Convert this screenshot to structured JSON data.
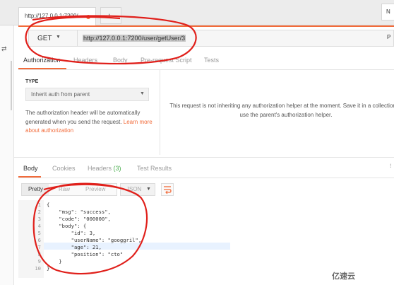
{
  "tabbar": {
    "tab_title": "http://127.0.0.1:7200/",
    "new_tab": "+",
    "env_label": "N"
  },
  "request": {
    "method": "GET",
    "url": "http://127.0.0.1:7200/user/getUser/3",
    "params_label": "P"
  },
  "request_tabs": [
    "Authorization",
    "Headers",
    "Body",
    "Pre-request Script",
    "Tests"
  ],
  "auth": {
    "type_label": "TYPE",
    "select_value": "Inherit auth from parent",
    "desc": "The authorization header will be automatically generated when you send the request.",
    "link": "Learn more about authorization",
    "message": "This request is not inheriting any authorization helper at the moment. Save it in a collection to use the parent's authorization helper."
  },
  "response_tabs": {
    "body": "Body",
    "cookies": "Cookies",
    "headers": "Headers",
    "headers_count": "(3)",
    "tests": "Test Results"
  },
  "view": {
    "pretty": "Pretty",
    "raw": "Raw",
    "preview": "Preview",
    "format": "JSON"
  },
  "code_lines": [
    "{",
    "    \"msg\": \"success\",",
    "    \"code\": \"000000\",",
    "    \"body\": {",
    "        \"id\": 3,",
    "        \"userName\": \"googgril\",",
    "        \"age\": 21,",
    "        \"position\": \"cto\"",
    "    }",
    "}"
  ],
  "watermark": "亿速云",
  "colors": {
    "accent": "#f26b3a",
    "annotation": "#e0201b",
    "count": "#4caf50"
  },
  "icons": {
    "wrap": "wrap-lines-icon",
    "dropdown": "chevron-down-icon"
  }
}
